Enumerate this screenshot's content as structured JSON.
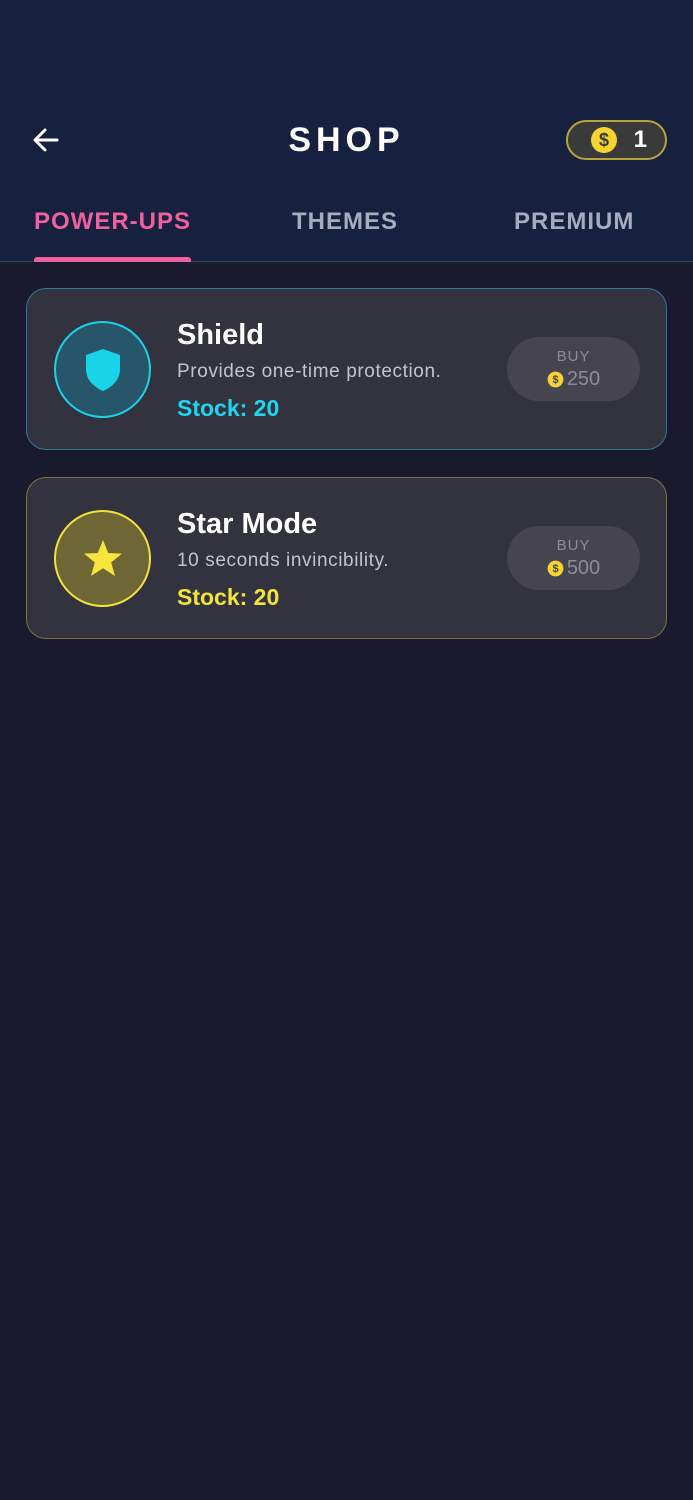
{
  "header": {
    "title": "SHOP",
    "coins": "1"
  },
  "tabs": [
    {
      "label": "POWER-UPS",
      "active": true
    },
    {
      "label": "THEMES",
      "active": false
    },
    {
      "label": "PREMIUM",
      "active": false
    }
  ],
  "items": [
    {
      "name": "Shield",
      "description": "Provides one-time protection.",
      "stock": "Stock: 20",
      "buy_label": "BUY",
      "price": "250",
      "icon": "shield-icon",
      "accent": "#19d3e8"
    },
    {
      "name": "Star Mode",
      "description": "10 seconds invincibility.",
      "stock": "Stock: 20",
      "buy_label": "BUY",
      "price": "500",
      "icon": "star-icon",
      "accent": "#f2e23c"
    }
  ],
  "colors": {
    "background": "#1a1a2e",
    "header": "#16203f",
    "active_tab": "#f0609e",
    "coin": "#f5d431"
  }
}
